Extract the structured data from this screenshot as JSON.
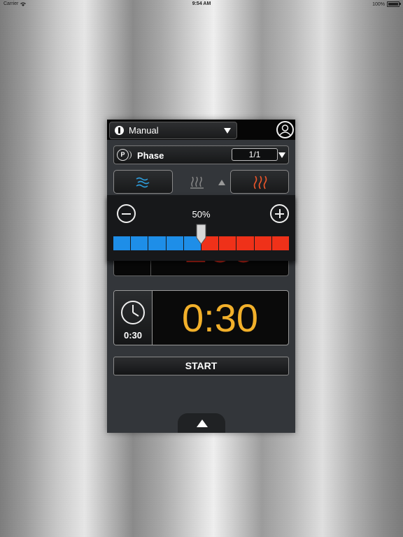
{
  "status_bar": {
    "carrier": "Carrier",
    "time": "9:54 AM",
    "battery": "100%"
  },
  "header": {
    "mode_label": "Manual",
    "mode_icon": "power-icon",
    "user_icon": "user-icon"
  },
  "phase": {
    "label": "Phase",
    "count": "1/1",
    "icon": "program-icon"
  },
  "tabs": {
    "steam_icon": "steam-icon",
    "combi_icon": "combi-icon",
    "hot_air_icon": "hot-air-icon"
  },
  "humidity": {
    "percent_label": "50%",
    "level_percent": 50,
    "segments_cold": 5,
    "segments_hot": 5
  },
  "temperature": {
    "value": "160"
  },
  "timer": {
    "small_value": "0:30",
    "value": "0:30"
  },
  "actions": {
    "start_label": "START"
  },
  "colors": {
    "cold": "#1e8ee8",
    "hot": "#ef3119",
    "timer": "#f2b02a",
    "temperature": "#e02a1c"
  }
}
